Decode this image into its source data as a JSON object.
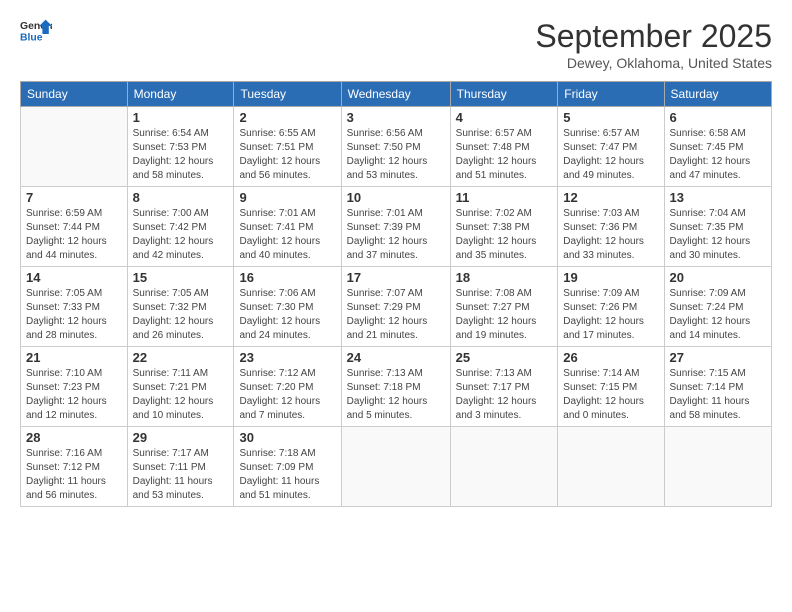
{
  "logo": {
    "line1": "General",
    "line2": "Blue"
  },
  "header": {
    "month": "September 2025",
    "location": "Dewey, Oklahoma, United States"
  },
  "weekdays": [
    "Sunday",
    "Monday",
    "Tuesday",
    "Wednesday",
    "Thursday",
    "Friday",
    "Saturday"
  ],
  "weeks": [
    [
      {
        "day": "",
        "sunrise": "",
        "sunset": "",
        "daylight": ""
      },
      {
        "day": "1",
        "sunrise": "Sunrise: 6:54 AM",
        "sunset": "Sunset: 7:53 PM",
        "daylight": "Daylight: 12 hours and 58 minutes."
      },
      {
        "day": "2",
        "sunrise": "Sunrise: 6:55 AM",
        "sunset": "Sunset: 7:51 PM",
        "daylight": "Daylight: 12 hours and 56 minutes."
      },
      {
        "day": "3",
        "sunrise": "Sunrise: 6:56 AM",
        "sunset": "Sunset: 7:50 PM",
        "daylight": "Daylight: 12 hours and 53 minutes."
      },
      {
        "day": "4",
        "sunrise": "Sunrise: 6:57 AM",
        "sunset": "Sunset: 7:48 PM",
        "daylight": "Daylight: 12 hours and 51 minutes."
      },
      {
        "day": "5",
        "sunrise": "Sunrise: 6:57 AM",
        "sunset": "Sunset: 7:47 PM",
        "daylight": "Daylight: 12 hours and 49 minutes."
      },
      {
        "day": "6",
        "sunrise": "Sunrise: 6:58 AM",
        "sunset": "Sunset: 7:45 PM",
        "daylight": "Daylight: 12 hours and 47 minutes."
      }
    ],
    [
      {
        "day": "7",
        "sunrise": "Sunrise: 6:59 AM",
        "sunset": "Sunset: 7:44 PM",
        "daylight": "Daylight: 12 hours and 44 minutes."
      },
      {
        "day": "8",
        "sunrise": "Sunrise: 7:00 AM",
        "sunset": "Sunset: 7:42 PM",
        "daylight": "Daylight: 12 hours and 42 minutes."
      },
      {
        "day": "9",
        "sunrise": "Sunrise: 7:01 AM",
        "sunset": "Sunset: 7:41 PM",
        "daylight": "Daylight: 12 hours and 40 minutes."
      },
      {
        "day": "10",
        "sunrise": "Sunrise: 7:01 AM",
        "sunset": "Sunset: 7:39 PM",
        "daylight": "Daylight: 12 hours and 37 minutes."
      },
      {
        "day": "11",
        "sunrise": "Sunrise: 7:02 AM",
        "sunset": "Sunset: 7:38 PM",
        "daylight": "Daylight: 12 hours and 35 minutes."
      },
      {
        "day": "12",
        "sunrise": "Sunrise: 7:03 AM",
        "sunset": "Sunset: 7:36 PM",
        "daylight": "Daylight: 12 hours and 33 minutes."
      },
      {
        "day": "13",
        "sunrise": "Sunrise: 7:04 AM",
        "sunset": "Sunset: 7:35 PM",
        "daylight": "Daylight: 12 hours and 30 minutes."
      }
    ],
    [
      {
        "day": "14",
        "sunrise": "Sunrise: 7:05 AM",
        "sunset": "Sunset: 7:33 PM",
        "daylight": "Daylight: 12 hours and 28 minutes."
      },
      {
        "day": "15",
        "sunrise": "Sunrise: 7:05 AM",
        "sunset": "Sunset: 7:32 PM",
        "daylight": "Daylight: 12 hours and 26 minutes."
      },
      {
        "day": "16",
        "sunrise": "Sunrise: 7:06 AM",
        "sunset": "Sunset: 7:30 PM",
        "daylight": "Daylight: 12 hours and 24 minutes."
      },
      {
        "day": "17",
        "sunrise": "Sunrise: 7:07 AM",
        "sunset": "Sunset: 7:29 PM",
        "daylight": "Daylight: 12 hours and 21 minutes."
      },
      {
        "day": "18",
        "sunrise": "Sunrise: 7:08 AM",
        "sunset": "Sunset: 7:27 PM",
        "daylight": "Daylight: 12 hours and 19 minutes."
      },
      {
        "day": "19",
        "sunrise": "Sunrise: 7:09 AM",
        "sunset": "Sunset: 7:26 PM",
        "daylight": "Daylight: 12 hours and 17 minutes."
      },
      {
        "day": "20",
        "sunrise": "Sunrise: 7:09 AM",
        "sunset": "Sunset: 7:24 PM",
        "daylight": "Daylight: 12 hours and 14 minutes."
      }
    ],
    [
      {
        "day": "21",
        "sunrise": "Sunrise: 7:10 AM",
        "sunset": "Sunset: 7:23 PM",
        "daylight": "Daylight: 12 hours and 12 minutes."
      },
      {
        "day": "22",
        "sunrise": "Sunrise: 7:11 AM",
        "sunset": "Sunset: 7:21 PM",
        "daylight": "Daylight: 12 hours and 10 minutes."
      },
      {
        "day": "23",
        "sunrise": "Sunrise: 7:12 AM",
        "sunset": "Sunset: 7:20 PM",
        "daylight": "Daylight: 12 hours and 7 minutes."
      },
      {
        "day": "24",
        "sunrise": "Sunrise: 7:13 AM",
        "sunset": "Sunset: 7:18 PM",
        "daylight": "Daylight: 12 hours and 5 minutes."
      },
      {
        "day": "25",
        "sunrise": "Sunrise: 7:13 AM",
        "sunset": "Sunset: 7:17 PM",
        "daylight": "Daylight: 12 hours and 3 minutes."
      },
      {
        "day": "26",
        "sunrise": "Sunrise: 7:14 AM",
        "sunset": "Sunset: 7:15 PM",
        "daylight": "Daylight: 12 hours and 0 minutes."
      },
      {
        "day": "27",
        "sunrise": "Sunrise: 7:15 AM",
        "sunset": "Sunset: 7:14 PM",
        "daylight": "Daylight: 11 hours and 58 minutes."
      }
    ],
    [
      {
        "day": "28",
        "sunrise": "Sunrise: 7:16 AM",
        "sunset": "Sunset: 7:12 PM",
        "daylight": "Daylight: 11 hours and 56 minutes."
      },
      {
        "day": "29",
        "sunrise": "Sunrise: 7:17 AM",
        "sunset": "Sunset: 7:11 PM",
        "daylight": "Daylight: 11 hours and 53 minutes."
      },
      {
        "day": "30",
        "sunrise": "Sunrise: 7:18 AM",
        "sunset": "Sunset: 7:09 PM",
        "daylight": "Daylight: 11 hours and 51 minutes."
      },
      {
        "day": "",
        "sunrise": "",
        "sunset": "",
        "daylight": ""
      },
      {
        "day": "",
        "sunrise": "",
        "sunset": "",
        "daylight": ""
      },
      {
        "day": "",
        "sunrise": "",
        "sunset": "",
        "daylight": ""
      },
      {
        "day": "",
        "sunrise": "",
        "sunset": "",
        "daylight": ""
      }
    ]
  ]
}
